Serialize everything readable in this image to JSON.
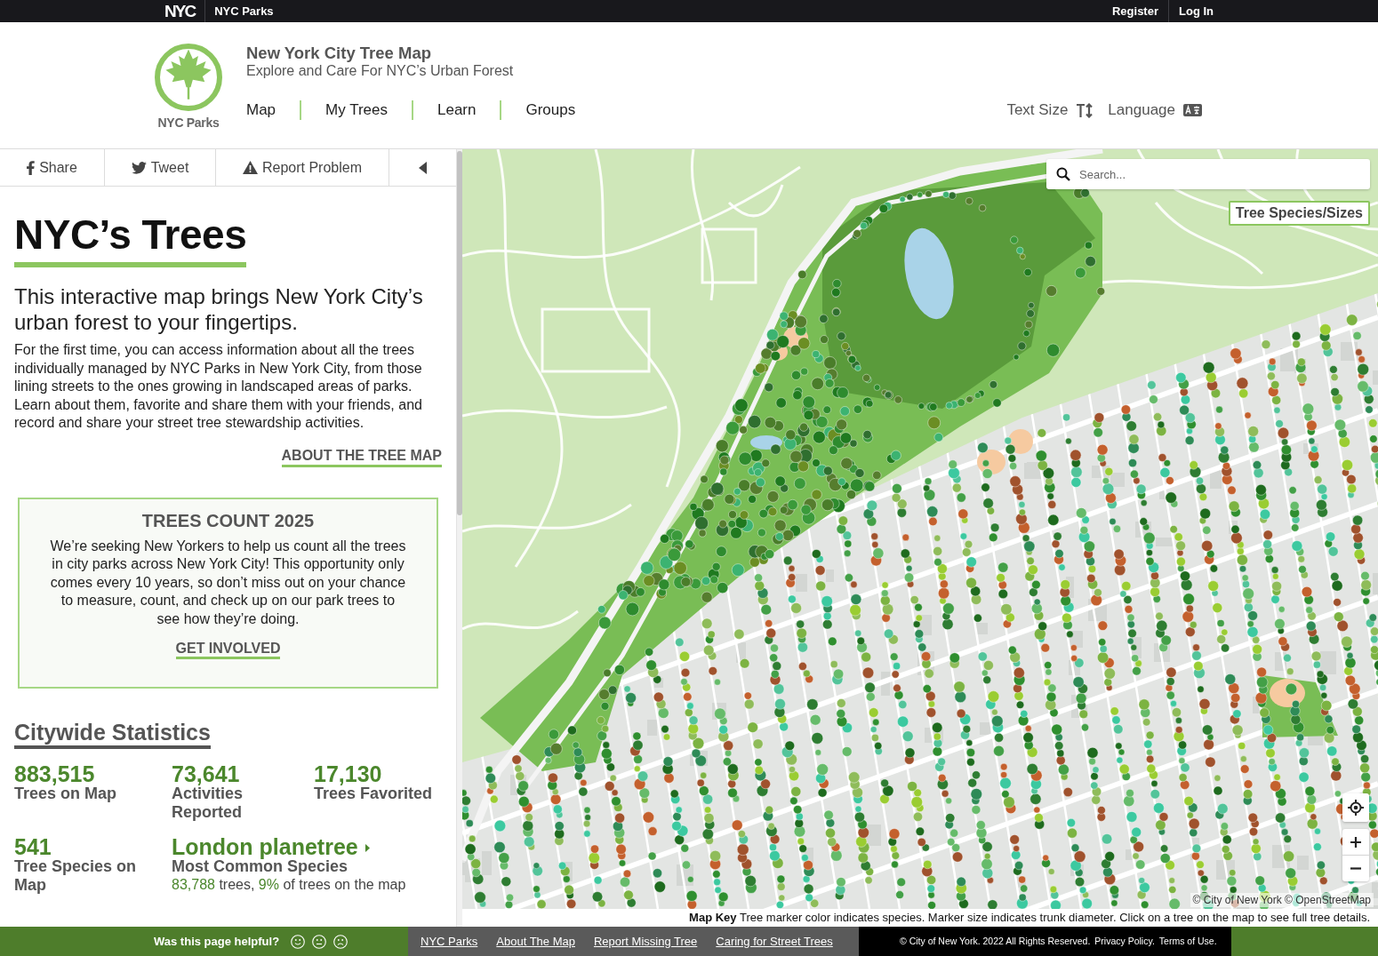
{
  "top_bar": {
    "logo": "NYC",
    "site_name": "NYC Parks",
    "links": [
      "Register",
      "Log In"
    ]
  },
  "header": {
    "logo_caption": "NYC Parks",
    "title": "New York City Tree Map",
    "subtitle": "Explore and Care For NYC’s Urban Forest",
    "nav": [
      "Map",
      "My Trees",
      "Learn",
      "Groups"
    ],
    "tools": [
      {
        "kind": "text_size",
        "label": "Text Size"
      },
      {
        "kind": "language",
        "label": "Language"
      }
    ]
  },
  "panel": {
    "actions": [
      {
        "kind": "share",
        "label": "Share"
      },
      {
        "kind": "tweet",
        "label": "Tweet"
      },
      {
        "kind": "report",
        "label": "Report Problem"
      },
      {
        "kind": "collapse"
      }
    ],
    "title": "NYC’s Trees",
    "lead": "This interactive map brings New York City’s urban forest to your fingertips.",
    "intro": "For the first time, you can access information about all the trees individually managed by NYC Parks in New York City, from those lining streets to the ones growing in landscaped areas of parks. Learn about them, favorite and share them with your friends, and record and share your street tree stewardship activities.",
    "about_link": "ABOUT THE TREE MAP",
    "promo": {
      "title": "TREES COUNT 2025",
      "text": "We’re seeking New Yorkers to help us count all the trees in city parks across New York City! This opportunity only comes every 10 years, so don’t miss out on your chance to measure, count, and check up on our park trees to see how they’re doing.",
      "link": "GET INVOLVED"
    },
    "statistics": {
      "title": "Citywide Statistics",
      "items": [
        {
          "value": "883,515",
          "label": "Trees on Map"
        },
        {
          "value": "73,641",
          "label": "Activities Reported"
        },
        {
          "value": "17,130",
          "label": "Trees Favorited"
        },
        {
          "value": "541",
          "label": "Tree Species on Map"
        }
      ],
      "top_species": {
        "name": "London planetree",
        "label": "Most Common Species",
        "detail": [
          {
            "text": "83,788",
            "highlight": true
          },
          {
            "text": " trees, ",
            "highlight": false
          },
          {
            "text": "9%",
            "highlight": true
          },
          {
            "text": " of trees on the map",
            "highlight": false
          }
        ]
      }
    }
  },
  "map": {
    "search": {
      "placeholder": "Search..."
    },
    "layers_button": "Tree Species/Sizes",
    "controls": [
      {
        "kind": "locate"
      },
      {
        "kind": "zoom_in"
      },
      {
        "kind": "zoom_out"
      }
    ],
    "attribution": "© City of New York © OpenStreetMap",
    "key": "**Map Key** Tree marker color indicates species. Marker size indicates trunk diameter. Click on a tree on the map to see full tree details."
  },
  "footer": {
    "question": "Was this page helpful?",
    "ratings": [
      {
        "kind": "happy"
      },
      {
        "kind": "neutral"
      },
      {
        "kind": "sad"
      }
    ],
    "links": [
      "NYC Parks",
      "About The Map",
      "Report Missing Tree",
      "Caring for Street Trees"
    ],
    "legal": [
      "© City of New York. 2022 All Rights Reserved.",
      "Privacy Policy.",
      "Terms of Use."
    ]
  }
}
